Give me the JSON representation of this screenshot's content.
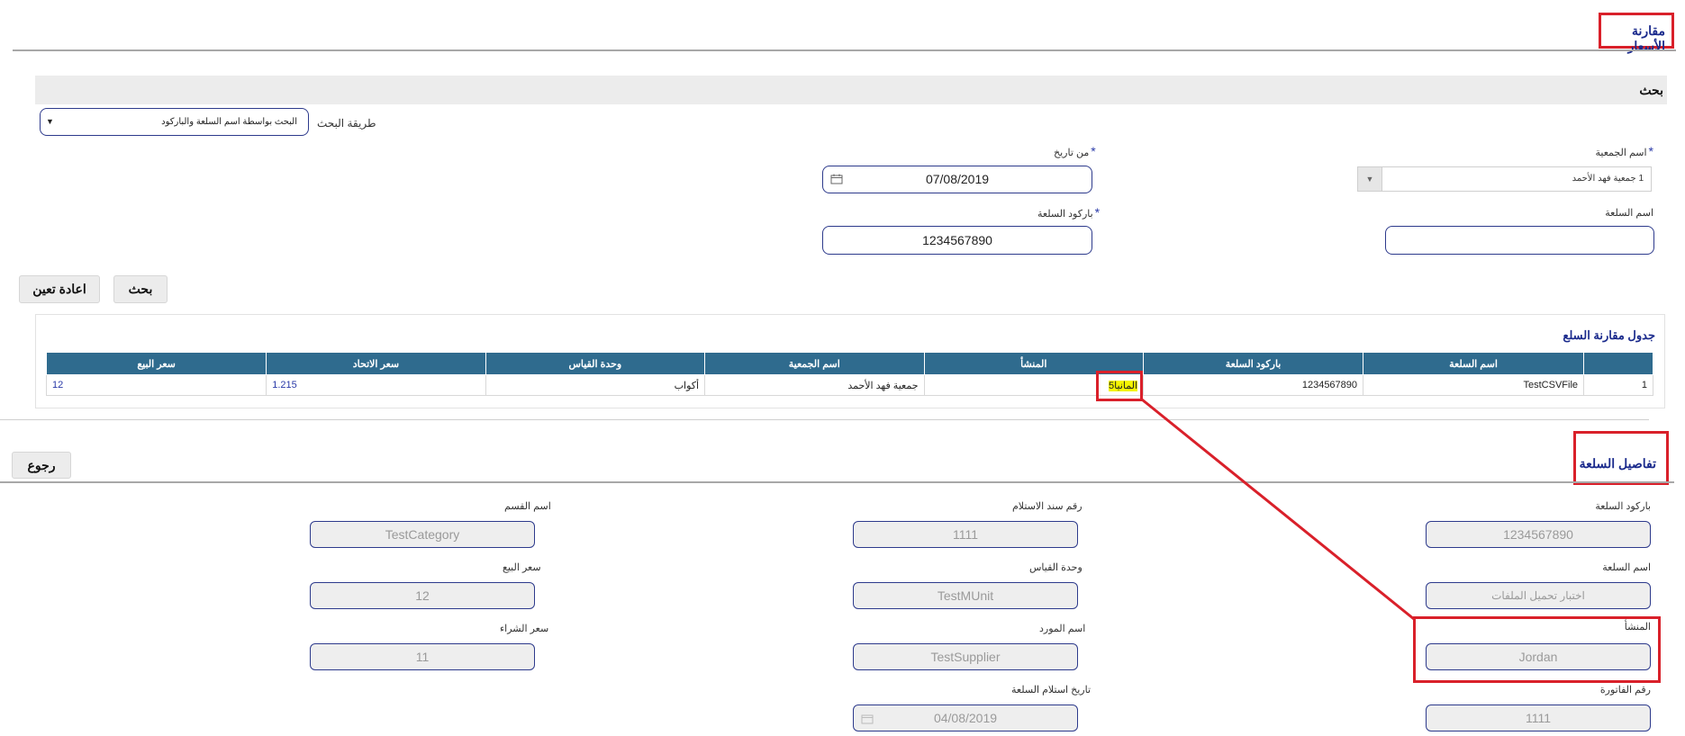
{
  "page": {
    "title": "مقارنة الأسعار"
  },
  "search": {
    "section_title": "بحث",
    "method_label": "طريقة البحث",
    "method_value": "البحث بواسطة اسم السلعة والباركود",
    "society_label": "اسم الجمعية",
    "society_value": "1 جمعية فهد الأحمد",
    "from_date_label": "من تاريخ",
    "from_date_value": "07/08/2019",
    "item_name_label": "اسم السلعة",
    "item_name_value": "",
    "barcode_label": "باركود السلعة",
    "barcode_value": "1234567890",
    "search_button": "بحث",
    "reset_button": "اعادة تعين"
  },
  "comparison": {
    "title": "جدول مقارنة السلع",
    "columns": [
      "",
      "اسم السلعة",
      "باركود السلعة",
      "المنشأ",
      "اسم الجمعية",
      "وحدة القياس",
      "سعر الاتحاد",
      "سعر البيع"
    ],
    "rows": [
      {
        "index": "1",
        "name": "TestCSVFile",
        "barcode": "1234567890",
        "origin": "المانيا5",
        "society": "جمعية فهد الأحمد",
        "unit": "أكواب",
        "union_price": "1.215",
        "sale_price": "12"
      }
    ]
  },
  "details": {
    "title": "تفاصيل السلعة",
    "back_button": "رجوع",
    "fields": {
      "barcode_label": "باركود السلعة",
      "barcode_value": "1234567890",
      "receipt_no_label": "رقم سند الاستلام",
      "receipt_no_value": "1111",
      "category_label": "اسم القسم",
      "category_value": "TestCategory",
      "item_name_label": "اسم السلعة",
      "item_name_value": "اختبار تحميل الملفات",
      "unit_label": "وحدة القياس",
      "unit_value": "TestMUnit",
      "sale_price_label": "سعر البيع",
      "sale_price_value": "12",
      "origin_label": "المنشأ",
      "origin_value": "Jordan",
      "supplier_label": "اسم المورد",
      "supplier_value": "TestSupplier",
      "purchase_price_label": "سعر الشراء",
      "purchase_price_value": "11",
      "invoice_label": "رقم الفاتورة",
      "invoice_value": "1111",
      "receive_date_label": "تاريخ استلام السلعة",
      "receive_date_value": "04/08/2019"
    }
  },
  "colors": {
    "header_row": "#2f6b8e",
    "annotation": "#d9202a",
    "highlight": "#f5f500",
    "title": "#1a2a8c"
  },
  "icons": [
    "calendar-icon",
    "chevron-down-icon",
    "triangle-down-icon"
  ]
}
